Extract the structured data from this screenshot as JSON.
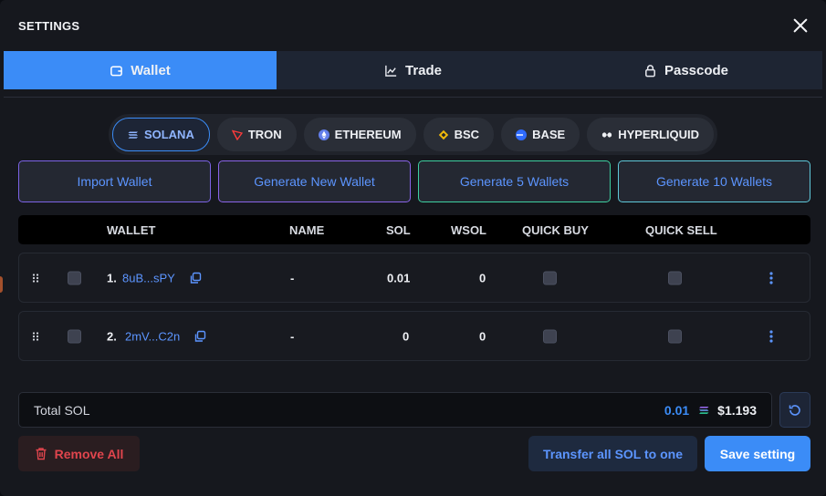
{
  "header": {
    "title": "SETTINGS"
  },
  "tabs": [
    {
      "label": "Wallet",
      "icon": "wallet-icon",
      "active": true
    },
    {
      "label": "Trade",
      "icon": "chart-icon",
      "active": false
    },
    {
      "label": "Passcode",
      "icon": "lock-icon",
      "active": false
    }
  ],
  "chains": [
    {
      "label": "SOLANA",
      "icon": "solana-icon",
      "active": true
    },
    {
      "label": "TRON",
      "icon": "tron-icon"
    },
    {
      "label": "ETHEREUM",
      "icon": "ethereum-icon"
    },
    {
      "label": "BSC",
      "icon": "bsc-icon"
    },
    {
      "label": "BASE",
      "icon": "base-icon"
    },
    {
      "label": "HYPERLIQUID",
      "icon": "hyperliquid-icon"
    }
  ],
  "actions": {
    "import": "Import Wallet",
    "generate_new": "Generate New Wallet",
    "generate_5": "Generate 5 Wallets",
    "generate_10": "Generate 10 Wallets"
  },
  "table": {
    "headers": {
      "wallet": "WALLET",
      "name": "NAME",
      "sol": "SOL",
      "wsol": "WSOL",
      "quick_buy": "QUICK BUY",
      "quick_sell": "QUICK SELL"
    },
    "rows": [
      {
        "index": "1.",
        "address": "8uB...sPY",
        "name": "-",
        "sol": "0.01",
        "wsol": "0"
      },
      {
        "index": "2.",
        "address": "2mV...C2n",
        "name": "-",
        "sol": "0",
        "wsol": "0"
      }
    ]
  },
  "total": {
    "label": "Total SOL",
    "sol": "0.01",
    "usd": "$1.193"
  },
  "footer": {
    "remove_all": "Remove All",
    "transfer": "Transfer all SOL to one",
    "save": "Save setting"
  },
  "colors": {
    "accent": "#3b8cf7",
    "danger": "#e0454d",
    "link": "#5c95ff"
  }
}
